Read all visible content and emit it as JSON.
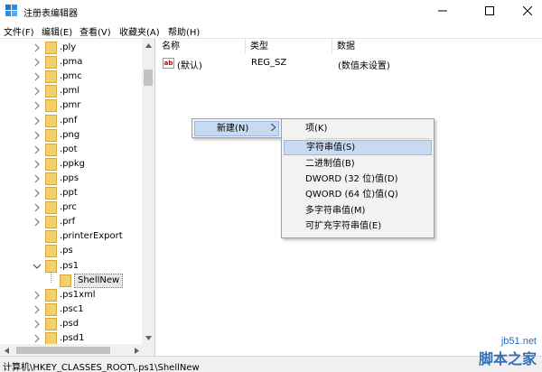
{
  "window": {
    "title": "注册表编辑器",
    "controls": {
      "minimize": "minimize",
      "maximize": "maximize",
      "close": "close"
    }
  },
  "menubar": {
    "items": [
      "文件(F)",
      "编辑(E)",
      "查看(V)",
      "收藏夹(A)",
      "帮助(H)"
    ]
  },
  "tree": {
    "items": [
      {
        "label": ".ply",
        "expandable": true
      },
      {
        "label": ".pma",
        "expandable": true
      },
      {
        "label": ".pmc",
        "expandable": true
      },
      {
        "label": ".pml",
        "expandable": true
      },
      {
        "label": ".pmr",
        "expandable": true
      },
      {
        "label": ".pnf",
        "expandable": true
      },
      {
        "label": ".png",
        "expandable": true
      },
      {
        "label": ".pot",
        "expandable": true
      },
      {
        "label": ".ppkg",
        "expandable": true
      },
      {
        "label": ".pps",
        "expandable": true
      },
      {
        "label": ".ppt",
        "expandable": true
      },
      {
        "label": ".prc",
        "expandable": true
      },
      {
        "label": ".prf",
        "expandable": true
      },
      {
        "label": ".printerExport",
        "expandable": false
      },
      {
        "label": ".ps",
        "expandable": false
      },
      {
        "label": ".ps1",
        "expandable": true,
        "expanded": true
      },
      {
        "label": "ShellNew",
        "child": true,
        "selected": true
      },
      {
        "label": ".ps1xml",
        "expandable": true
      },
      {
        "label": ".psc1",
        "expandable": true
      },
      {
        "label": ".psd",
        "expandable": true
      },
      {
        "label": ".psd1",
        "expandable": true
      }
    ]
  },
  "list": {
    "headers": {
      "name": "名称",
      "type": "类型",
      "data": "数据"
    },
    "rows": [
      {
        "icon": "ab",
        "name": "(默认)",
        "type": "REG_SZ",
        "data": "(数值未设置)"
      }
    ]
  },
  "context_menu": {
    "new_label": "新建(N)",
    "submenu": [
      {
        "label": "项(K)"
      },
      {
        "label": "字符串值(S)",
        "highlighted": true
      },
      {
        "label": "二进制值(B)"
      },
      {
        "label": "DWORD (32 位)值(D)"
      },
      {
        "label": "QWORD (64 位)值(Q)"
      },
      {
        "label": "多字符串值(M)"
      },
      {
        "label": "可扩充字符串值(E)"
      }
    ]
  },
  "statusbar": {
    "path": "计算机\\HKEY_CLASSES_ROOT\\.ps1\\ShellNew"
  },
  "watermark": {
    "url": "jb51.net",
    "name": "脚本之家"
  },
  "colors": {
    "folder": "#f5d06a",
    "highlight": "#c8daf2",
    "accent": "#2e6fb8"
  }
}
